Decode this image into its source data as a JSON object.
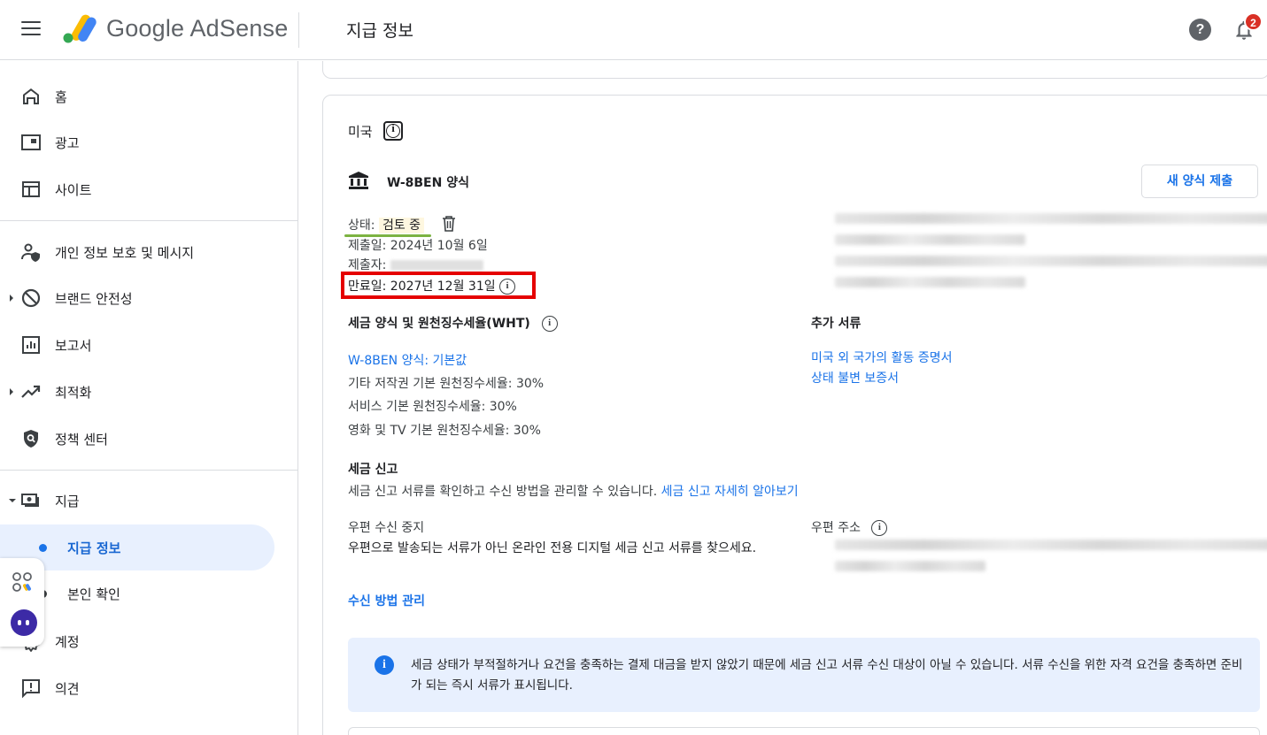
{
  "app": {
    "brand": "Google AdSense",
    "page_title": "지급 정보",
    "notification_count": "2",
    "help_icon": "help-icon",
    "accent_color": "#1a73e8"
  },
  "sidebar": {
    "items": [
      {
        "label": "홈",
        "icon": "home-icon"
      },
      {
        "label": "광고",
        "icon": "ads-icon"
      },
      {
        "label": "사이트",
        "icon": "sites-icon"
      },
      {
        "label": "개인 정보 보호 및 메시지",
        "icon": "privacy-messaging-icon"
      },
      {
        "label": "브랜드 안전성",
        "icon": "block-icon"
      },
      {
        "label": "보고서",
        "icon": "reports-icon"
      },
      {
        "label": "최적화",
        "icon": "trending-up-icon"
      },
      {
        "label": "정책 센터",
        "icon": "policy-shield-icon"
      },
      {
        "label": "지급",
        "icon": "payments-icon"
      },
      {
        "label": "계정",
        "icon": "settings-gear-icon"
      },
      {
        "label": "의견",
        "icon": "feedback-icon"
      }
    ],
    "sub_items": [
      {
        "label": "지급 정보",
        "active": true
      },
      {
        "label": "본인 확인",
        "active": false
      }
    ]
  },
  "tax": {
    "country": "미국",
    "form_name": "W-8BEN 양식",
    "new_form_button": "새 양식 제출",
    "status_label": "상태:",
    "status_value": "검토 중",
    "submitted": "제출일: 2024년 10월 6일",
    "submitter_label": "제출자:",
    "expiry": "만료일: 2027년 12월 31일",
    "wht_title": "세금 양식 및 원천징수세율(WHT)",
    "wht_link": "W-8BEN 양식: 기본값",
    "wht_rates": [
      "기타 저작권 기본 원천징수세율: 30%",
      "서비스 기본 원천징수세율: 30%",
      "영화 및 TV 기본 원천징수세율: 30%"
    ],
    "additional_docs_title": "추가 서류",
    "additional_docs": [
      "미국 외 국가의 활동 증명서",
      "상태 불변 보증서"
    ],
    "tax_filing_title": "세금 신고",
    "tax_filing_desc": "세금 신고 서류를 확인하고 수신 방법을 관리할 수 있습니다.",
    "tax_filing_link": "세금 신고 자세히 알아보기",
    "postal_stop_title": "우편 수신 중지",
    "postal_stop_desc": "우편으로 발송되는 서류가 아닌 온라인 전용 디지털 세금 신고 서류를 찾으세요.",
    "postal_address_title": "우편 주소",
    "manage_link": "수신 방법 관리",
    "notice": "세금 상태가 부적절하거나 요건을 충족하는 결제 대금을 받지 않았기 때문에 세금 신고 서류 수신 대상이 아닐 수 있습니다. 서류 수신을 위한 자격 요건을 충족하면 준비가 되는 즉시 서류가 표시됩니다."
  }
}
